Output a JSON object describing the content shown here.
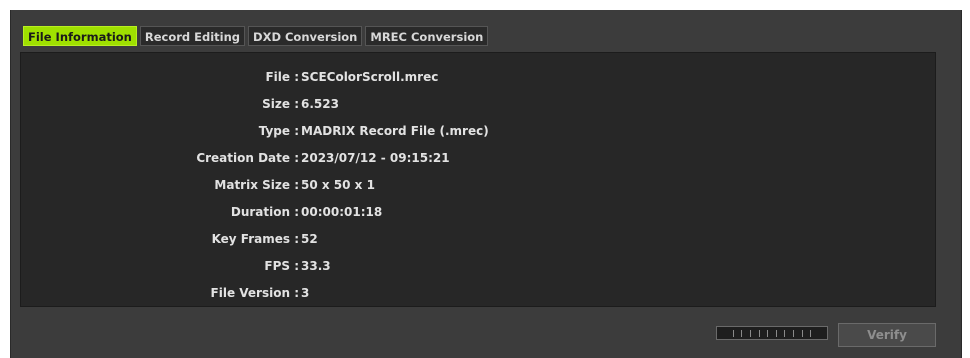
{
  "tabs": [
    {
      "label": "File Information",
      "active": true
    },
    {
      "label": "Record Editing",
      "active": false
    },
    {
      "label": "DXD Conversion",
      "active": false
    },
    {
      "label": "MREC Conversion",
      "active": false
    }
  ],
  "file_info": [
    {
      "label": "File :",
      "value": "SCEColorScroll.mrec"
    },
    {
      "label": "Size :",
      "value": "6.523"
    },
    {
      "label": "Type :",
      "value": "MADRIX Record File (.mrec)"
    },
    {
      "label": "Creation Date :",
      "value": "2023/07/12 - 09:15:21"
    },
    {
      "label": "Matrix Size :",
      "value": "50 x 50 x 1"
    },
    {
      "label": "Duration :",
      "value": "00:00:01:18"
    },
    {
      "label": "Key Frames :",
      "value": "52"
    },
    {
      "label": "FPS :",
      "value": "33.3"
    },
    {
      "label": "File Version :",
      "value": "3"
    }
  ],
  "progress": {
    "fraction": 0
  },
  "verify_button": {
    "label": "Verify",
    "enabled": false
  },
  "colors": {
    "active_tab": "#9fe000",
    "panel_bg": "#272727",
    "window_bg": "#3c3c3c"
  }
}
